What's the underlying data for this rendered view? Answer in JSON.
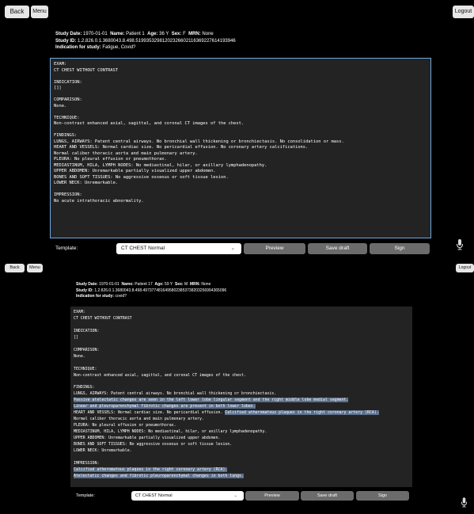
{
  "top": {
    "back_label": "Back",
    "menu_label": "Menu",
    "logout_label": "Logout",
    "study": {
      "date_label": "Study Date:",
      "date": "1970-01-01",
      "name_label": "Name:",
      "name": "Patient 1",
      "age_label": "Age:",
      "age": "36 Y",
      "sex_label": "Sex:",
      "sex": "F",
      "mrn_label": "MRN:",
      "mrn": "None",
      "id_label": "Study ID:",
      "id": "1.2.826.0.1.3680043.8.498.51993532981202326602116369227614193946",
      "indication_label": "Indication for study:",
      "indication": "Fatigue, Covid?"
    },
    "report_lines": [
      {
        "text": "EXAM:"
      },
      {
        "text": "CT CHEST WITHOUT CONTRAST"
      },
      {
        "text": ""
      },
      {
        "text": "INDICATION:"
      },
      {
        "text": "[]|"
      },
      {
        "text": ""
      },
      {
        "text": "COMPARISON:"
      },
      {
        "text": "None."
      },
      {
        "text": ""
      },
      {
        "text": "TECHNIQUE:"
      },
      {
        "text": "Non-contrast enhanced axial, sagittal, and coronal CT images of the chest."
      },
      {
        "text": ""
      },
      {
        "text": "FINDINGS:"
      },
      {
        "text": "LUNGS, AIRWAYS: Patent central airways. No bronchial wall thickening or bronchiectasis. No consolidation or mass."
      },
      {
        "text": "HEART AND VESSELS: Normal cardiac size. No pericardial effusion. No coronary artery calcifications."
      },
      {
        "text": "Normal caliber thoracic aorta and main pulmonary artery."
      },
      {
        "text": "PLEURA: No pleural effusion or pneumothorax."
      },
      {
        "text": "MEDIASTINUM, HILA, LYMPH NODES: No mediastinal, hilar, or axillary lymphadenopathy."
      },
      {
        "text": "UPPER ABDOMEN: Unremarkable partially visualized upper abdomen."
      },
      {
        "text": "BONES AND SOFT TISSUES: No aggressive osseous or soft tissue lesion."
      },
      {
        "text": "LOWER NECK: Unremarkable."
      },
      {
        "text": ""
      },
      {
        "text": "IMPRESSION:"
      },
      {
        "text": "No acute intrathoracic abnormality."
      }
    ],
    "template_label": "Template:",
    "template_value": "CT CHEST Normal",
    "preview_label": "Preview",
    "save_label": "Save draft",
    "sign_label": "Sign"
  },
  "bottom": {
    "back_label": "Back",
    "menu_label": "Menu",
    "logout_label": "Logout",
    "study": {
      "date_label": "Study Date:",
      "date": "1970-01-01",
      "name_label": "Name:",
      "name": "Patient 17",
      "age_label": "Age:",
      "age": "59 Y",
      "sex_label": "Sex:",
      "sex": "M",
      "mrn_label": "MRN:",
      "mrn": "None",
      "id_label": "Study ID:",
      "id": "1.2.826.0.1.3680043.8.498.49737748164958023853738203256994365096",
      "indication_label": "Indication for study:",
      "indication": "covid?"
    },
    "report_lines": [
      {
        "text": "EXAM:"
      },
      {
        "text": "CT CHEST WITHOUT CONTRAST"
      },
      {
        "text": ""
      },
      {
        "text": "INDICATION:"
      },
      {
        "text": "[]"
      },
      {
        "text": ""
      },
      {
        "text": "COMPARISON:"
      },
      {
        "text": "None."
      },
      {
        "text": ""
      },
      {
        "text": "TECHNIQUE:"
      },
      {
        "text": "Non-contrast enhanced axial, sagittal, and coronal CT images of the chest."
      },
      {
        "text": ""
      },
      {
        "text": "FINDINGS:"
      },
      {
        "text": "LUNGS, AIRWAYS: Patent central airways. No bronchial wall thickening or bronchiectasis."
      },
      {
        "text": "Passive atelectatic changes are seen in the left lower lobe lingular segment and the right middle lobe medial segment.",
        "highlight": true
      },
      {
        "text": "Linear and pleuroparenchymal fibrotic changes are present in both lower lobes.",
        "highlight": true
      },
      {
        "text": "HEART AND VESSELS: Normal cardiac size. No pericardial effusion. ",
        "highlight_tail": "Calcified atheromatous plaques in the right coronary artery (RCA)."
      },
      {
        "text": "Normal caliber thoracic aorta and main pulmonary artery."
      },
      {
        "text": "PLEURA: No pleural effusion or pneumothorax."
      },
      {
        "text": "MEDIASTINUM, HILA, LYMPH NODES: No mediastinal, hilar, or axillary lymphadenopathy."
      },
      {
        "text": "UPPER ABDOMEN: Unremarkable partially visualized upper abdomen."
      },
      {
        "text": "BONES AND SOFT TISSUES: No aggressive osseous or soft tissue lesion."
      },
      {
        "text": "LOWER NECK: Unremarkable."
      },
      {
        "text": ""
      },
      {
        "text": "IMPRESSION:"
      },
      {
        "text": "Calcified atheromatous plaques in the right coronary artery (RCA).",
        "highlight": true
      },
      {
        "text": "Atelectatic changes and fibrotic pleuroparenchymal changes in both lungs.",
        "highlight": true
      }
    ],
    "template_label": "Template:",
    "template_value": "CT CHEST Normal",
    "preview_label": "Preview",
    "save_label": "Save draft",
    "sign_label": "Sign"
  },
  "icons": {
    "mic": "microphone-icon",
    "select_chevron": "chevron-down-icon"
  },
  "colors": {
    "report_border": "#6fa8dc",
    "action_button": "#6b6b6b",
    "highlight": "#5b6e8a"
  }
}
